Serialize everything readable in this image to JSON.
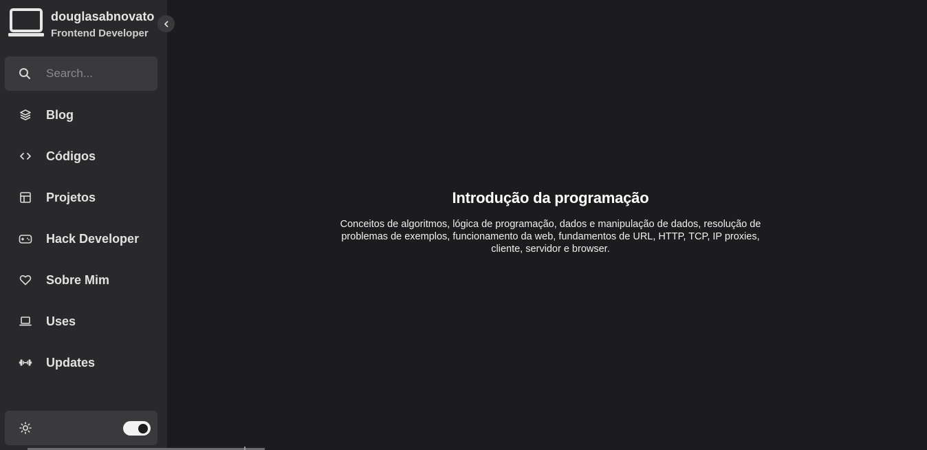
{
  "profile": {
    "name": "douglasabnovato",
    "role": "Frontend Developer",
    "icon": "laptop-icon"
  },
  "sidebar": {
    "collapse_icon": "chevron-left-icon",
    "search": {
      "placeholder": "Search...",
      "value": ""
    },
    "items": [
      {
        "label": "Blog",
        "icon": "layers-icon"
      },
      {
        "label": "Códigos",
        "icon": "code-icon"
      },
      {
        "label": "Projetos",
        "icon": "layout-icon"
      },
      {
        "label": "Hack Developer",
        "icon": "gamepad-icon"
      },
      {
        "label": "Sobre Mim",
        "icon": "heart-icon"
      },
      {
        "label": "Uses",
        "icon": "laptop-icon"
      },
      {
        "label": "Updates",
        "icon": "dumbbell-icon"
      }
    ],
    "theme": {
      "icon": "sun-icon",
      "dark_mode": true
    }
  },
  "main": {
    "title": "Introdução da programação",
    "description": "Conceitos de algoritmos, lógica de programação, dados e manipulação de dados, resolução de problemas de exemplos, funcionamento da web, fundamentos de URL, HTTP, TCP, IP proxies, cliente, servidor e browser."
  },
  "colors": {
    "sidebar_bg": "#29292c",
    "main_bg": "#1c1c1e",
    "panel_bg": "#3a3a3d",
    "text": "#e2e2e2"
  }
}
